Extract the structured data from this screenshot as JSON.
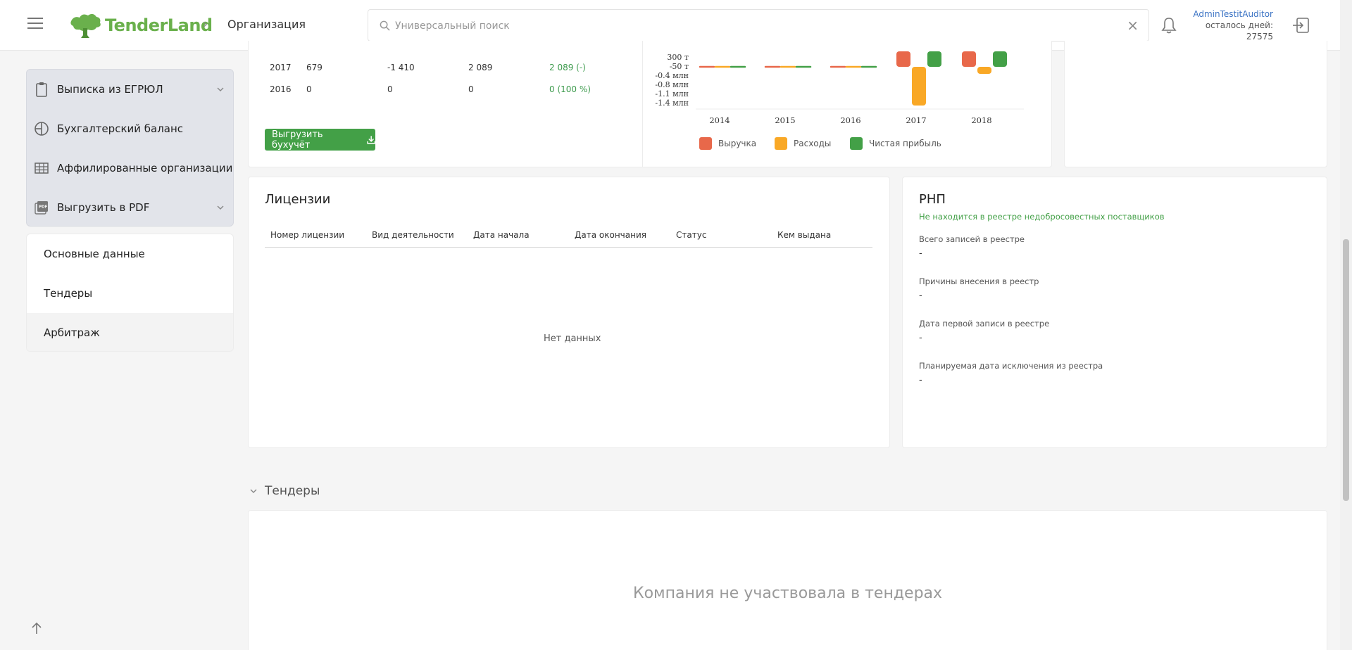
{
  "header": {
    "logo_text": "TenderLand",
    "breadcrumb_sep": "›",
    "page_title": "Организация",
    "search_placeholder": "Универсальный поиск",
    "clear_glyph": "×",
    "user_name": "AdminTestitAuditor",
    "user_days_label": "осталось дней:",
    "user_days_value": "27575"
  },
  "sidebar": {
    "menu": [
      {
        "label": "Выписка из ЕГРЮЛ",
        "icon": "clipboard-icon",
        "has_dropdown": true
      },
      {
        "label": "Бухгалтерский баланс",
        "icon": "pie-chart-icon",
        "has_dropdown": false
      },
      {
        "label": "Аффилированные организации",
        "icon": "table-icon",
        "has_dropdown": false
      },
      {
        "label": "Выгрузить в PDF",
        "icon": "pdf-icon",
        "has_dropdown": true
      }
    ],
    "nav": [
      {
        "label": "Основные данные",
        "active": false
      },
      {
        "label": "Тендеры",
        "active": false
      },
      {
        "label": "Арбитраж",
        "active": true
      }
    ]
  },
  "finance": {
    "rows": [
      {
        "year": "2017",
        "revenue": "679",
        "expenses": "-1 410",
        "profit": "2 089",
        "change": "2 089 (-)"
      },
      {
        "year": "2016",
        "revenue": "0",
        "expenses": "0",
        "profit": "0",
        "change": "0 (100 %)"
      }
    ],
    "export_label": "Выгрузить бухучёт"
  },
  "chart_data": {
    "type": "bar",
    "categories": [
      "2014",
      "2015",
      "2016",
      "2017",
      "2018"
    ],
    "y_tick_labels": [
      "300 т",
      "-50 т",
      "-0.4 млн",
      "-0.8 млн",
      "-1.1 млн",
      "-1.4 млн"
    ],
    "series": [
      {
        "name": "Выручка",
        "color": "#e8684a",
        "values": [
          0,
          0,
          0,
          679000,
          700000
        ]
      },
      {
        "name": "Расходы",
        "color": "#f9a826",
        "values": [
          0,
          0,
          0,
          -1410000,
          -250000
        ]
      },
      {
        "name": "Чистая прибыль",
        "color": "#43a047",
        "values": [
          0,
          0,
          0,
          2089000,
          700000
        ]
      }
    ],
    "legend_position": "bottom"
  },
  "licenses": {
    "title": "Лицензии",
    "columns": [
      "Номер лицензии",
      "Вид деятельности",
      "Дата начала",
      "Дата окончания",
      "Статус",
      "Кем выдана"
    ],
    "empty_text": "Нет данных"
  },
  "rnp": {
    "title": "РНП",
    "status": "Не находится в реестре недобросовестных поставщиков",
    "fields": [
      {
        "label": "Всего записей в реестре",
        "value": "-"
      },
      {
        "label": "Причины внесения в реестр",
        "value": "-"
      },
      {
        "label": "Дата первой записи в реестре",
        "value": "-"
      },
      {
        "label": "Планируемая дата исключения из реестра",
        "value": "-"
      }
    ]
  },
  "tenders": {
    "title": "Тендеры",
    "empty_text": "Компания не участвовала в тендерах"
  }
}
